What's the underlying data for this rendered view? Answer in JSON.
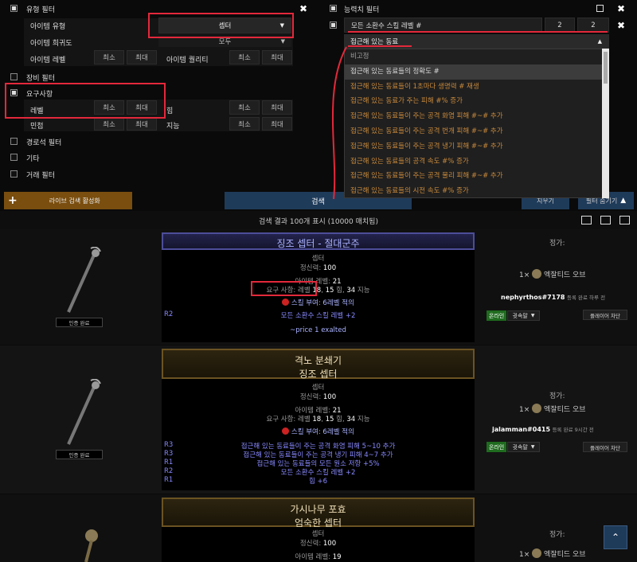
{
  "filters": {
    "type_filter": "유형 필터",
    "item_category_label": "아이템 유형",
    "item_category_value": "셉터",
    "rarity_label": "아이템 희귀도",
    "rarity_value": "모두",
    "item_level_label": "아이템 레벨",
    "quality_label": "아이템 퀄리티",
    "min": "최소",
    "max": "최대",
    "equipment_filter": "장비 필터",
    "requirements": "요구사항",
    "level_label": "레벨",
    "str_label": "힘",
    "dex_label": "민첩",
    "int_label": "지능",
    "endgame_filter": "경로석 필터",
    "misc_filter": "기타",
    "trade_filter": "거래 필터"
  },
  "stat_filters": {
    "title": "능력치 필터",
    "stat1": "모든 소환수 스킬 레벨 #",
    "stat1_min": "2",
    "stat1_max": "2",
    "search_text": "접근해 있는 동료",
    "options": [
      "비고정",
      "접근해 있는 동료들의 정확도 #",
      "접근해 있는 동료들이 1초마다 생명력 # 재생",
      "접근해 있는 동료가 주는 피해 #% 증가",
      "접근해 있는 동료들이 주는 공격 화염 피해 #~# 추가",
      "접근해 있는 동료들이 주는 공격 번개 피해 #~# 추가",
      "접근해 있는 동료들이 주는 공격 냉기 피해 #~# 추가",
      "접근해 있는 동료들의 공격 속도 #% 증가",
      "접근해 있는 동료들이 주는 공격 물리 피해 #~# 추가",
      "접근해 있는 동료들의 시전 속도 #% 증가"
    ]
  },
  "actions": {
    "live": "라이브 검색 활성화",
    "search": "검색",
    "clear": "지우기",
    "hide_filters": "필터 숨기기"
  },
  "results": {
    "summary": "검색 결과 100개 표시 (10000 매치됨)"
  },
  "items": [
    {
      "name": "징조 셉터 - 절대군주",
      "type": "셉터",
      "spirit_label": "정신력:",
      "spirit": "100",
      "ilvl_label": "아이템 레벨:",
      "ilvl": "21",
      "req_label": "요구 사항:",
      "req_level_label": "레벨",
      "req_level": "18",
      "req_str": "15",
      "str": "힘",
      "req_int": "34",
      "int": "지능",
      "grant": "스킬 부여: 6레벨 적의",
      "mods": [
        {
          "tier": "R2",
          "text": "모든 소환수 스킬 레벨 +2"
        }
      ],
      "note": "~price 1 exalted",
      "verified": "인증 완료",
      "price_label": "정가:",
      "price_qty": "1×",
      "price_currency": "엑잘티드 오브",
      "seller": "nephyrthos#7178",
      "listed": "등록 완료 하루 전",
      "online": "온라인",
      "whisper": "귓속말",
      "block": "플레이어 차단"
    },
    {
      "name": "격노 분쇄기",
      "base": "징조 셉터",
      "type": "셉터",
      "spirit_label": "정신력:",
      "spirit": "100",
      "ilvl_label": "아이템 레벨:",
      "ilvl": "21",
      "req_label": "요구 사항:",
      "req_level_label": "레벨",
      "req_level": "18",
      "req_str": "15",
      "str": "힘",
      "req_int": "34",
      "int": "지능",
      "grant": "스킬 부여: 6레벨 적의",
      "mods": [
        {
          "tier": "R3",
          "text": "접근해 있는 동료들이 주는 공격 화염 피해 5~10 추가"
        },
        {
          "tier": "R3",
          "text": "접근해 있는 동료들이 주는 공격 냉기 피해 4~7 추가"
        },
        {
          "tier": "R1",
          "text": "접근해 있는 동료들의 모든 원소 저항 +5%"
        },
        {
          "tier": "R2",
          "text": "모든 소환수 스킬 레벨 +2"
        },
        {
          "tier": "R1",
          "text": "힘 +6"
        }
      ],
      "verified": "인증 완료",
      "price_label": "정가:",
      "price_qty": "1×",
      "price_currency": "엑잘티드 오브",
      "seller": "jalamman#0415",
      "listed": "등록 완료 9시간 전",
      "online": "온라인",
      "whisper": "귓속말",
      "block": "플레이어 차단"
    },
    {
      "name": "가시나무 포효",
      "base": "엄숙한 셉터",
      "type": "셉터",
      "spirit_label": "정신력:",
      "spirit": "100",
      "ilvl_label": "아이템 레벨:",
      "ilvl": "19",
      "price_label": "정가:",
      "price_qty": "1×",
      "price_currency": "엑잘티드 오브"
    }
  ],
  "colors": {
    "accent_gold": "#c98a3c",
    "magic_blue": "#8888ff",
    "highlight_red": "#e3283b",
    "search_blue": "#1f3b5a",
    "live_orange": "#7a4e0f"
  }
}
